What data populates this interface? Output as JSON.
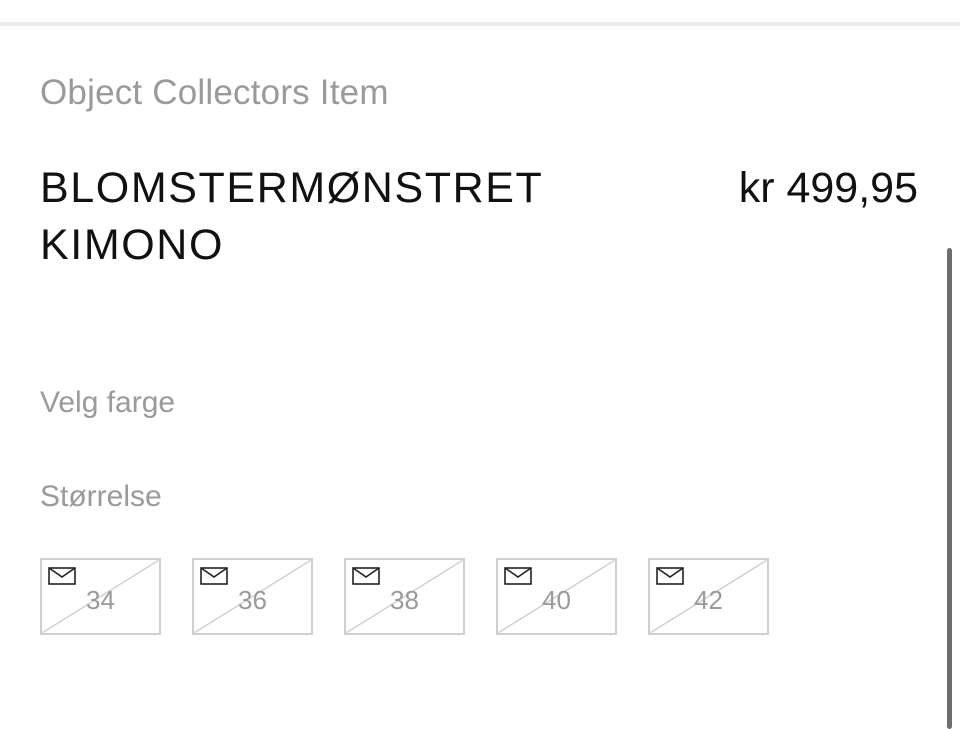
{
  "product": {
    "brand": "Object Collectors Item",
    "name": "BLOMSTERMØNSTRET KIMONO",
    "price": "kr 499,95"
  },
  "options": {
    "color_label": "Velg farge",
    "size_label": "Størrelse",
    "sizes": [
      {
        "label": "34",
        "available": false,
        "icon": "envelope-icon"
      },
      {
        "label": "36",
        "available": false,
        "icon": "envelope-icon"
      },
      {
        "label": "38",
        "available": false,
        "icon": "envelope-icon"
      },
      {
        "label": "40",
        "available": false,
        "icon": "envelope-icon"
      },
      {
        "label": "42",
        "available": false,
        "icon": "envelope-icon"
      }
    ]
  },
  "colors": {
    "text_primary": "#111111",
    "text_muted": "#9a9a9a",
    "border": "#cfcfcf",
    "background": "#ffffff"
  }
}
